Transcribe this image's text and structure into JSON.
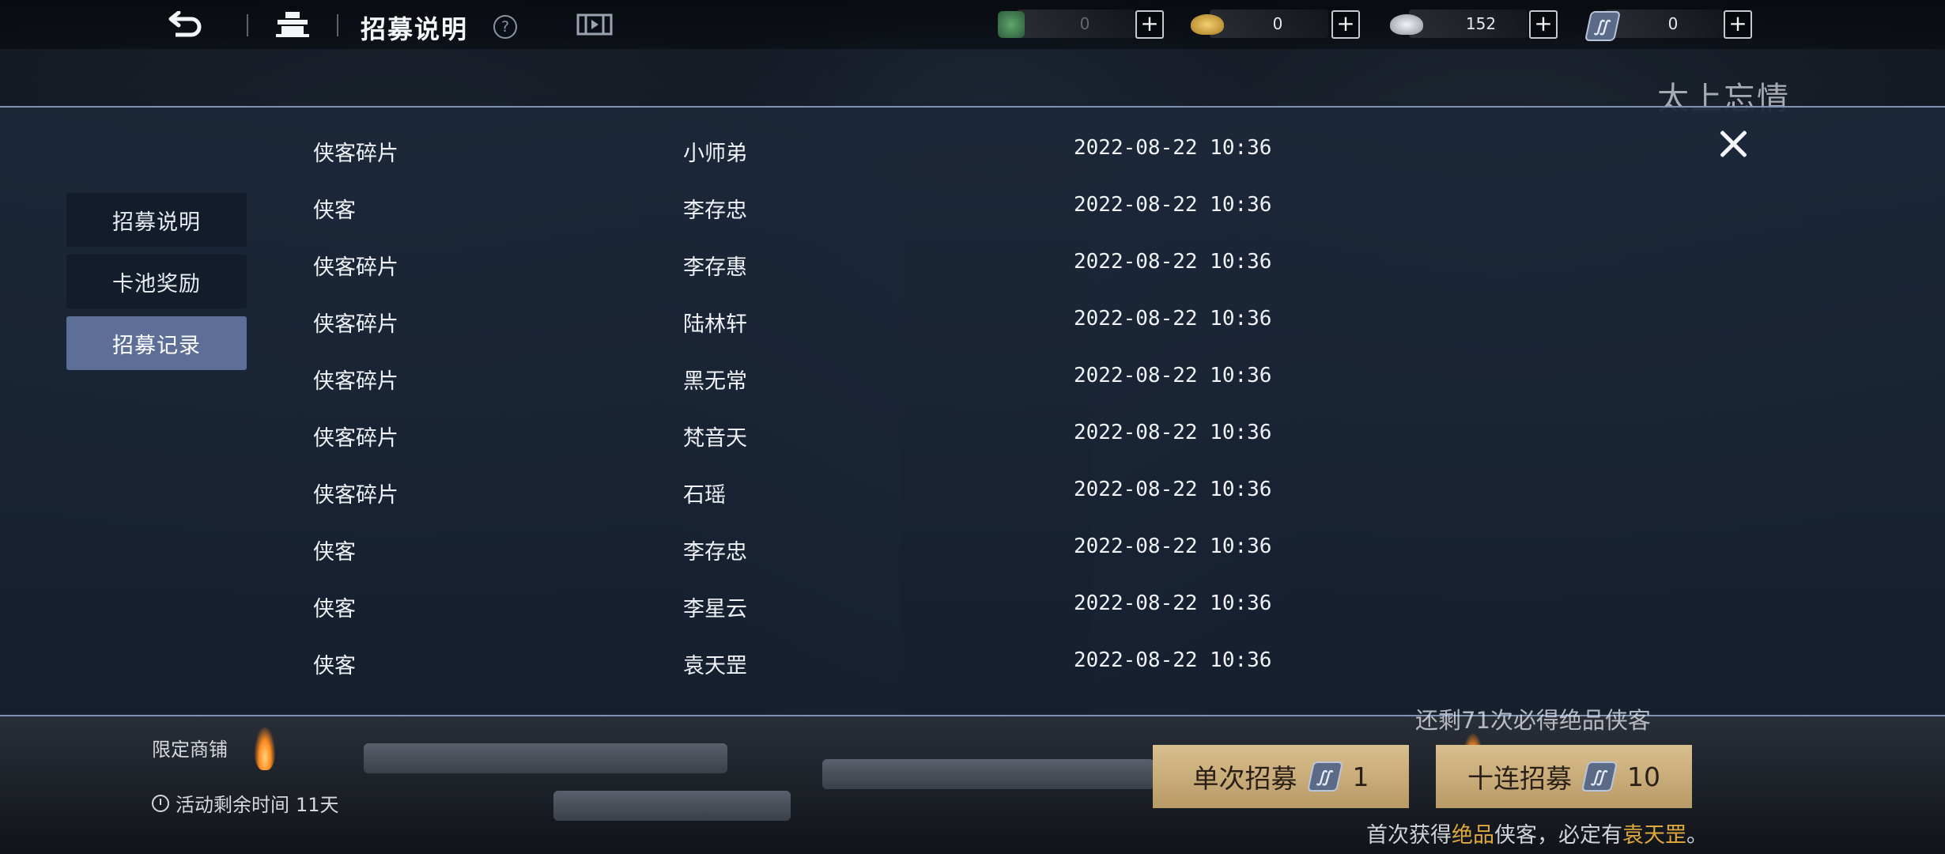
{
  "header": {
    "title": "招募说明",
    "icons": [
      "back-arrow-icon",
      "home-icon",
      "help-icon",
      "video-icon"
    ],
    "currencies": [
      {
        "icon": "jade-icon",
        "value": "0"
      },
      {
        "icon": "gold-ingot-icon",
        "value": "0"
      },
      {
        "icon": "silver-ingot-icon",
        "value": "152"
      },
      {
        "icon": "recruit-token-icon",
        "value": "0"
      }
    ]
  },
  "background": {
    "hero_name": "太上忘情"
  },
  "sidebar": {
    "tabs": [
      {
        "label": "招募说明",
        "active": false
      },
      {
        "label": "卡池奖励",
        "active": false
      },
      {
        "label": "招募记录",
        "active": true
      }
    ]
  },
  "records": [
    {
      "type": "侠客碎片",
      "name": "小师弟",
      "time": "2022-08-22 10:36"
    },
    {
      "type": "侠客",
      "name": "李存忠",
      "time": "2022-08-22 10:36"
    },
    {
      "type": "侠客碎片",
      "name": "李存惠",
      "time": "2022-08-22 10:36"
    },
    {
      "type": "侠客碎片",
      "name": "陆林轩",
      "time": "2022-08-22 10:36"
    },
    {
      "type": "侠客碎片",
      "name": "黑无常",
      "time": "2022-08-22 10:36"
    },
    {
      "type": "侠客碎片",
      "name": "梵音天",
      "time": "2022-08-22 10:36"
    },
    {
      "type": "侠客碎片",
      "name": "石瑶",
      "time": "2022-08-22 10:36"
    },
    {
      "type": "侠客",
      "name": "李存忠",
      "time": "2022-08-22 10:36"
    },
    {
      "type": "侠客",
      "name": "李星云",
      "time": "2022-08-22 10:36"
    },
    {
      "type": "侠客",
      "name": "袁天罡",
      "time": "2022-08-22 10:36"
    }
  ],
  "bottom": {
    "pity_text": "还剩71次必得绝品侠客",
    "single_label": "单次招募",
    "single_cost": "1",
    "ten_label": "十连招募",
    "ten_cost": "10",
    "guarantee_prefix": "首次获得",
    "guarantee_quality": "绝品",
    "guarantee_mid": "侠客，必定有",
    "guarantee_hero": "袁天罡",
    "guarantee_suffix": "。",
    "shop_label": "限定商铺",
    "timer_label": "活动剩余时间",
    "timer_value": "11天"
  },
  "colors": {
    "panel_border": "#7f92b4",
    "active_tab": "#5d6f97",
    "inactive_tab": "#131c2a",
    "button_gold": "#d9bf8e",
    "highlight_gold": "#e0a93e"
  }
}
